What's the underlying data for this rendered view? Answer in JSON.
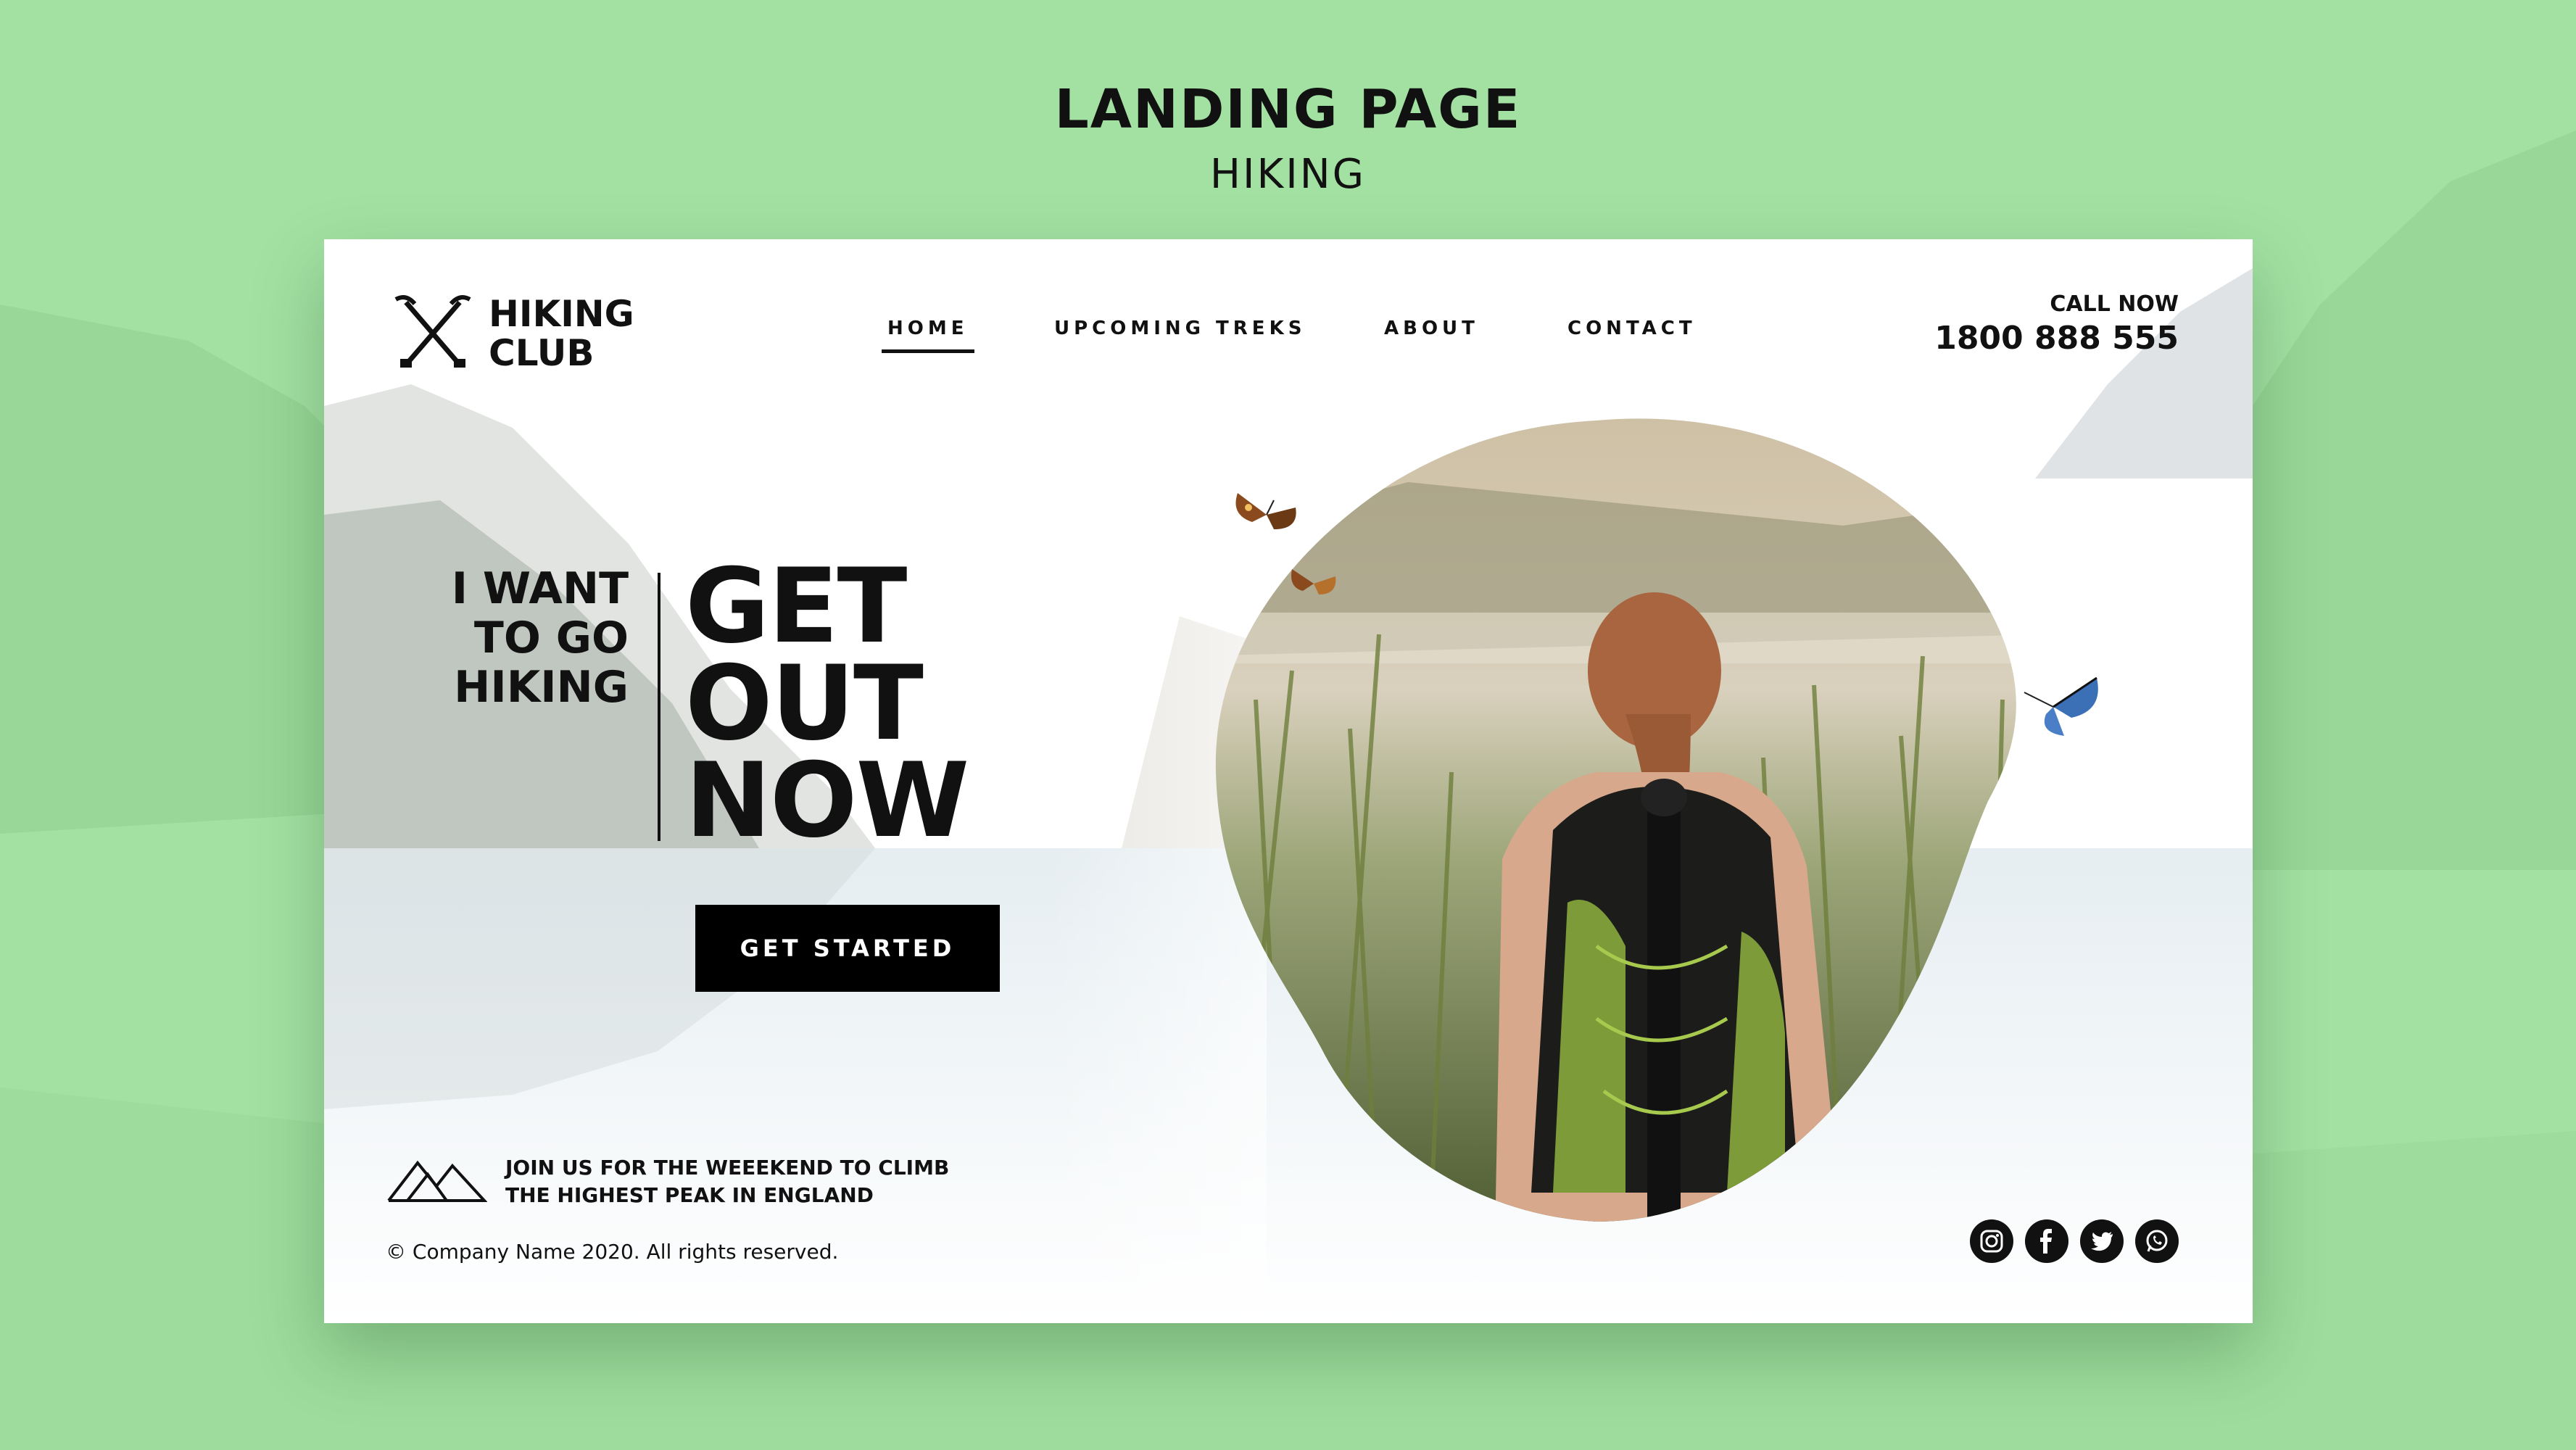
{
  "header": {
    "title": "LANDING PAGE",
    "subtitle": "HIKING"
  },
  "brand": {
    "name_line1": "HIKING",
    "name_line2": "CLUB",
    "icon": "crossed-trekking-poles-icon"
  },
  "nav": {
    "items": [
      {
        "label": "HOME",
        "active": true
      },
      {
        "label": "UPCOMING TREKS",
        "active": false
      },
      {
        "label": "ABOUT",
        "active": false
      },
      {
        "label": "CONTACT",
        "active": false
      }
    ]
  },
  "call": {
    "label": "CALL NOW",
    "number": "1800 888 555"
  },
  "hero": {
    "small_lines": [
      "I WANT",
      "TO GO",
      "HIKING"
    ],
    "big_lines": [
      "GET",
      "OUT",
      "NOW"
    ],
    "cta_label": "GET STARTED",
    "photo_subject": "hiker-with-backpack-image"
  },
  "footer": {
    "tagline_line1": "JOIN US FOR THE WEEEKEND TO CLIMB",
    "tagline_line2": "THE HIGHEST PEAK IN ENGLAND",
    "tagline_icon": "mountains-icon",
    "copyright": "© Company Name 2020. All rights reserved.",
    "socials": [
      "instagram-icon",
      "facebook-icon",
      "twitter-icon",
      "whatsapp-icon"
    ]
  },
  "colors": {
    "background": "#a3e1a3",
    "card": "#ffffff",
    "text": "#111111",
    "button": "#000000"
  }
}
